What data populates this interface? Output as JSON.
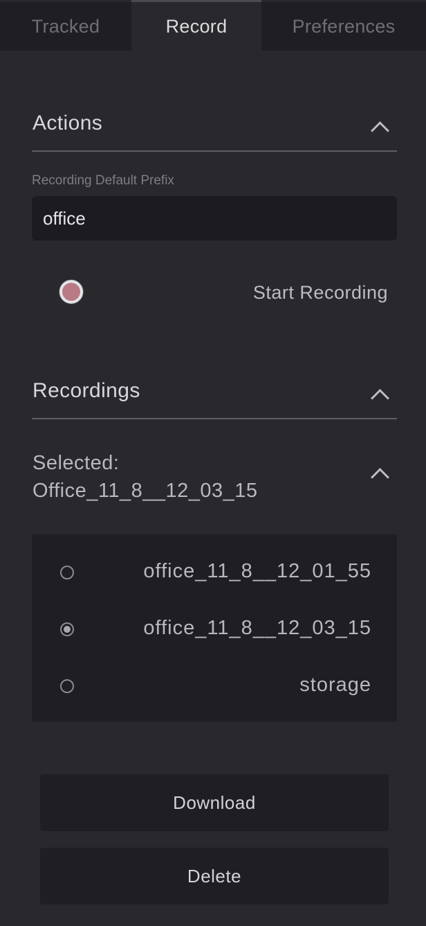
{
  "tabs": [
    {
      "label": "Tracked",
      "active": false
    },
    {
      "label": "Record",
      "active": true
    },
    {
      "label": "Preferences",
      "active": false
    }
  ],
  "actions": {
    "title": "Actions",
    "prefix_label": "Recording Default Prefix",
    "prefix_value": "office",
    "start_label": "Start Recording"
  },
  "recordings": {
    "title": "Recordings",
    "selected_prefix": "Selected:",
    "selected_name": "Office_11_8__12_03_15",
    "items": [
      {
        "label": "office_11_8__12_01_55",
        "checked": false
      },
      {
        "label": "office_11_8__12_03_15",
        "checked": true
      },
      {
        "label": "storage",
        "checked": false
      }
    ],
    "download_label": "Download",
    "delete_label": "Delete"
  },
  "colors": {
    "background": "#28282d",
    "panel": "#1f1f23",
    "record_button": "#b97a86"
  },
  "icons": {
    "collapse": "chevron-up-icon",
    "record": "record-dot-icon"
  }
}
